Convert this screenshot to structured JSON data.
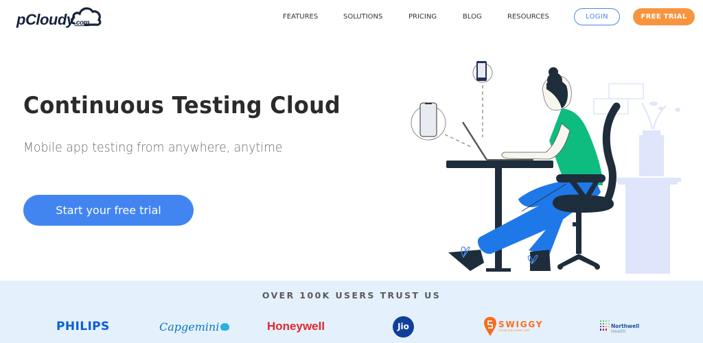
{
  "header": {
    "logo": {
      "name": "pCloudy",
      "suffix": ".com"
    },
    "nav": [
      {
        "label": "FEATURES"
      },
      {
        "label": "SOLUTIONS"
      },
      {
        "label": "PRICING"
      },
      {
        "label": "BLOG"
      },
      {
        "label": "RESOURCES"
      }
    ],
    "login_label": "LOGIN",
    "free_trial_label": "FREE TRIAL"
  },
  "hero": {
    "title": "Continuous Testing Cloud",
    "subtitle": "Mobile app testing from anywhere, anytime",
    "cta_label": "Start your free trial"
  },
  "trust": {
    "title": "OVER 100K USERS TRUST US",
    "brands": [
      {
        "name": "PHILIPS",
        "color": "#0b5ed7"
      },
      {
        "name": "Capgemini",
        "color": "#0a74c8"
      },
      {
        "name": "Honeywell",
        "color": "#e1262d"
      },
      {
        "name": "Jio",
        "color": "#0f3f9c"
      },
      {
        "name": "SWIGGY",
        "tagline": "FOOD DELIVERY APP",
        "color": "#fc6b1d"
      },
      {
        "name": "Northwell",
        "tagline": "Health",
        "color": "#1f4e9c"
      }
    ]
  },
  "colors": {
    "primary_blue": "#4285f0",
    "accent_orange": "#f7953f",
    "navy": "#14233c",
    "trust_bg": "#e4f1fc"
  }
}
